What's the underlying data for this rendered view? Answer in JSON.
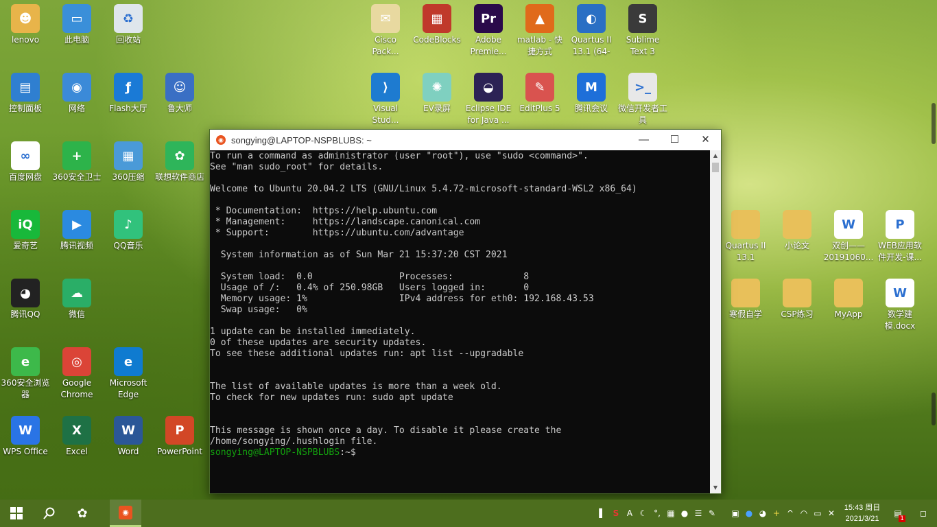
{
  "desktop_icons": [
    {
      "label": "lenovo",
      "icon": "folder-user-icon",
      "color": "#e8b44a",
      "glyph": "☻"
    },
    {
      "label": "此电脑",
      "icon": "computer-icon",
      "color": "#3a8fd9",
      "glyph": "▭"
    },
    {
      "label": "回收站",
      "icon": "recycle-bin-icon",
      "color": "#dfe6ec",
      "glyph": "♻"
    },
    {
      "label": "控制面板",
      "icon": "control-panel-icon",
      "color": "#2f7fd0",
      "glyph": "▤"
    },
    {
      "label": "网络",
      "icon": "network-icon",
      "color": "#3b8ad8",
      "glyph": "◉"
    },
    {
      "label": "Flash大厅",
      "icon": "flash-icon",
      "color": "#1a7ad6",
      "glyph": "ƒ"
    },
    {
      "label": "鲁大师",
      "icon": "ludashi-icon",
      "color": "#3a6fc4",
      "glyph": "☺"
    },
    {
      "label": "百度网盘",
      "icon": "baidu-netdisk-icon",
      "color": "#ffffff",
      "glyph": "∞"
    },
    {
      "label": "360安全卫士",
      "icon": "360-security-icon",
      "color": "#2db34a",
      "glyph": "+"
    },
    {
      "label": "360压缩",
      "icon": "360-zip-icon",
      "color": "#4a9ad8",
      "glyph": "▦"
    },
    {
      "label": "联想软件商店",
      "icon": "lenovo-store-icon",
      "color": "#2eb55a",
      "glyph": "✿"
    },
    {
      "label": "爱奇艺",
      "icon": "iqiyi-icon",
      "color": "#18b83a",
      "glyph": "iQ"
    },
    {
      "label": "腾讯视频",
      "icon": "tencent-video-icon",
      "color": "#2b8ae0",
      "glyph": "▶"
    },
    {
      "label": "QQ音乐",
      "icon": "qq-music-icon",
      "color": "#31c27c",
      "glyph": "♪"
    },
    {
      "label": "腾讯QQ",
      "icon": "qq-icon",
      "color": "#222222",
      "glyph": "◕"
    },
    {
      "label": "微信",
      "icon": "wechat-icon",
      "color": "#2aae67",
      "glyph": "☁"
    },
    {
      "label": "360安全浏览器",
      "icon": "360-browser-icon",
      "color": "#3db94a",
      "glyph": "e"
    },
    {
      "label": "Google Chrome",
      "icon": "chrome-icon",
      "color": "#db4437",
      "glyph": "◎"
    },
    {
      "label": "Microsoft Edge",
      "icon": "edge-icon",
      "color": "#0f7bd0",
      "glyph": "e"
    },
    {
      "label": "WPS Office",
      "icon": "wps-icon",
      "color": "#2a74e5",
      "glyph": "W"
    },
    {
      "label": "Excel",
      "icon": "excel-icon",
      "color": "#1e7145",
      "glyph": "X"
    },
    {
      "label": "Word",
      "icon": "word-icon",
      "color": "#2b5797",
      "glyph": "W"
    },
    {
      "label": "PowerPoint",
      "icon": "powerpoint-icon",
      "color": "#d24726",
      "glyph": "P"
    },
    {
      "label": "Cisco Pack...",
      "icon": "cisco-packet-tracer-icon",
      "color": "#e8d9a0",
      "glyph": "✉"
    },
    {
      "label": "CodeBlocks",
      "icon": "codeblocks-icon",
      "color": "#c0392b",
      "glyph": "▦"
    },
    {
      "label": "Adobe Premie...",
      "icon": "premiere-icon",
      "color": "#2a0a4a",
      "glyph": "Pr"
    },
    {
      "label": "matlab - 快捷方式",
      "icon": "matlab-icon",
      "color": "#e06a1b",
      "glyph": "▲"
    },
    {
      "label": "Quartus II 13.1 (64-bit)",
      "icon": "quartus-icon",
      "color": "#2a6fc4",
      "glyph": "◐"
    },
    {
      "label": "Sublime Text 3",
      "icon": "sublime-icon",
      "color": "#3a3a3a",
      "glyph": "S"
    },
    {
      "label": "Visual Stud...",
      "icon": "vscode-icon",
      "color": "#1e7bd0",
      "glyph": "⟩"
    },
    {
      "label": "EV录屏",
      "icon": "ev-recorder-icon",
      "color": "#7fd0c0",
      "glyph": "✺"
    },
    {
      "label": "Eclipse IDE for Java ...",
      "icon": "eclipse-icon",
      "color": "#2c2255",
      "glyph": "◒"
    },
    {
      "label": "EditPlus 5",
      "icon": "editplus-icon",
      "color": "#d9534f",
      "glyph": "✎"
    },
    {
      "label": "腾讯会议",
      "icon": "tencent-meeting-icon",
      "color": "#1e6fd9",
      "glyph": "M"
    },
    {
      "label": "微信开发者工具",
      "icon": "wechat-devtools-icon",
      "color": "#e8e8e8",
      "glyph": ">_"
    },
    {
      "label": "Quartus II 13.1",
      "icon": "folder-icon",
      "color": "#e8c05a",
      "glyph": ""
    },
    {
      "label": "小论文",
      "icon": "folder-icon",
      "color": "#e8c05a",
      "glyph": ""
    },
    {
      "label": "双创——20191060...",
      "icon": "word-doc-icon",
      "color": "#ffffff",
      "glyph": "W"
    },
    {
      "label": "WEB应用软件开发-课...",
      "icon": "pdf-icon",
      "color": "#ffffff",
      "glyph": "P"
    },
    {
      "label": "寒假自学",
      "icon": "folder-icon",
      "color": "#e8c05a",
      "glyph": ""
    },
    {
      "label": "CSP练习",
      "icon": "folder-icon",
      "color": "#e8c05a",
      "glyph": ""
    },
    {
      "label": "MyApp",
      "icon": "folder-icon",
      "color": "#e8c05a",
      "glyph": ""
    },
    {
      "label": "数学建模.docx",
      "icon": "word-doc-icon",
      "color": "#ffffff",
      "glyph": "W"
    }
  ],
  "terminal": {
    "title": "songying@LAPTOP-NSPBLUBS: ~",
    "lines": [
      "To run a command as administrator (user \"root\"), use \"sudo <command>\".",
      "See \"man sudo_root\" for details.",
      "",
      "Welcome to Ubuntu 20.04.2 LTS (GNU/Linux 5.4.72-microsoft-standard-WSL2 x86_64)",
      "",
      " * Documentation:  https://help.ubuntu.com",
      " * Management:     https://landscape.canonical.com",
      " * Support:        https://ubuntu.com/advantage",
      "",
      "  System information as of Sun Mar 21 15:37:20 CST 2021",
      "",
      "  System load:  0.0                Processes:             8",
      "  Usage of /:   0.4% of 250.98GB   Users logged in:       0",
      "  Memory usage: 1%                 IPv4 address for eth0: 192.168.43.53",
      "  Swap usage:   0%",
      "",
      "1 update can be installed immediately.",
      "0 of these updates are security updates.",
      "To see these additional updates run: apt list --upgradable",
      "",
      "",
      "The list of available updates is more than a week old.",
      "To check for new updates run: sudo apt update",
      "",
      "",
      "This message is shown once a day. To disable it please create the",
      "/home/songying/.hushlogin file."
    ],
    "prompt_user": "songying@LAPTOP-NSPBLUBS",
    "prompt_suffix": ":~$"
  },
  "taskbar": {
    "time": "15:43 周日",
    "date": "2021/3/21",
    "notification_badge": "1"
  }
}
